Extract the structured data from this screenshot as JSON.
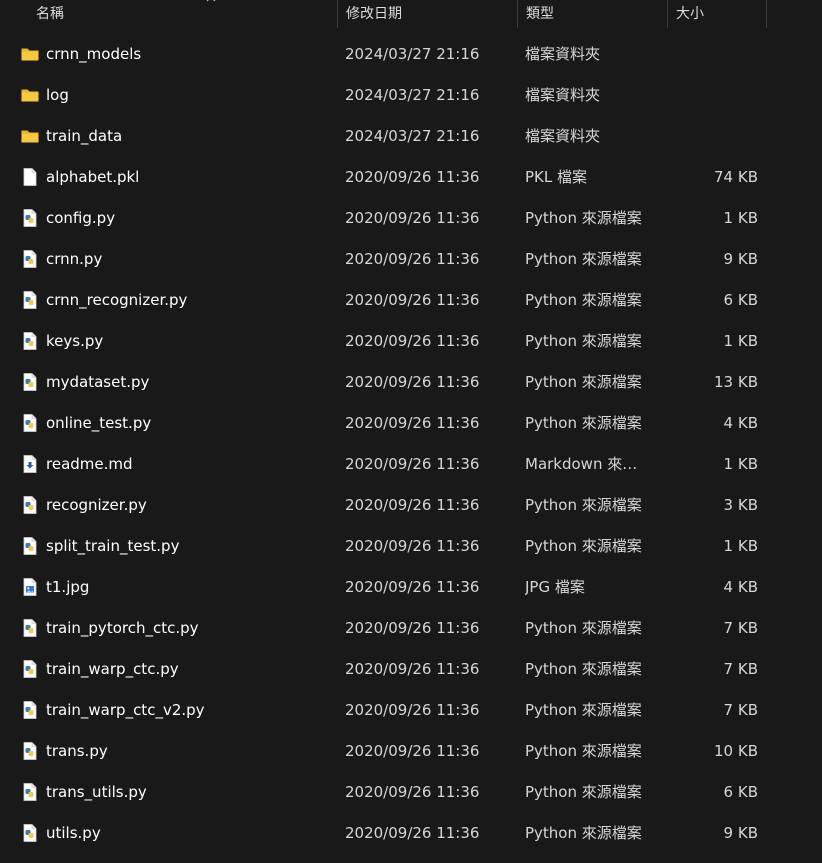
{
  "columns": {
    "name": "名稱",
    "modified": "修改日期",
    "type": "類型",
    "size": "大小"
  },
  "files": [
    {
      "name": "crnn_models",
      "modified": "2024/03/27 21:16",
      "type": "檔案資料夾",
      "size": "",
      "icon": "folder-icon"
    },
    {
      "name": "log",
      "modified": "2024/03/27 21:16",
      "type": "檔案資料夾",
      "size": "",
      "icon": "folder-icon"
    },
    {
      "name": "train_data",
      "modified": "2024/03/27 21:16",
      "type": "檔案資料夾",
      "size": "",
      "icon": "folder-icon"
    },
    {
      "name": "alphabet.pkl",
      "modified": "2020/09/26 11:36",
      "type": "PKL 檔案",
      "size": "74 KB",
      "icon": "blank-file-icon"
    },
    {
      "name": "config.py",
      "modified": "2020/09/26 11:36",
      "type": "Python 來源檔案",
      "size": "1 KB",
      "icon": "python-file-icon"
    },
    {
      "name": "crnn.py",
      "modified": "2020/09/26 11:36",
      "type": "Python 來源檔案",
      "size": "9 KB",
      "icon": "python-file-icon"
    },
    {
      "name": "crnn_recognizer.py",
      "modified": "2020/09/26 11:36",
      "type": "Python 來源檔案",
      "size": "6 KB",
      "icon": "python-file-icon"
    },
    {
      "name": "keys.py",
      "modified": "2020/09/26 11:36",
      "type": "Python 來源檔案",
      "size": "1 KB",
      "icon": "python-file-icon"
    },
    {
      "name": "mydataset.py",
      "modified": "2020/09/26 11:36",
      "type": "Python 來源檔案",
      "size": "13 KB",
      "icon": "python-file-icon"
    },
    {
      "name": "online_test.py",
      "modified": "2020/09/26 11:36",
      "type": "Python 來源檔案",
      "size": "4 KB",
      "icon": "python-file-icon"
    },
    {
      "name": "readme.md",
      "modified": "2020/09/26 11:36",
      "type": "Markdown 來源檔案",
      "size": "1 KB",
      "icon": "markdown-file-icon"
    },
    {
      "name": "recognizer.py",
      "modified": "2020/09/26 11:36",
      "type": "Python 來源檔案",
      "size": "3 KB",
      "icon": "python-file-icon"
    },
    {
      "name": "split_train_test.py",
      "modified": "2020/09/26 11:36",
      "type": "Python 來源檔案",
      "size": "1 KB",
      "icon": "python-file-icon"
    },
    {
      "name": "t1.jpg",
      "modified": "2020/09/26 11:36",
      "type": "JPG 檔案",
      "size": "4 KB",
      "icon": "image-file-icon"
    },
    {
      "name": "train_pytorch_ctc.py",
      "modified": "2020/09/26 11:36",
      "type": "Python 來源檔案",
      "size": "7 KB",
      "icon": "python-file-icon"
    },
    {
      "name": "train_warp_ctc.py",
      "modified": "2020/09/26 11:36",
      "type": "Python 來源檔案",
      "size": "7 KB",
      "icon": "python-file-icon"
    },
    {
      "name": "train_warp_ctc_v2.py",
      "modified": "2020/09/26 11:36",
      "type": "Python 來源檔案",
      "size": "7 KB",
      "icon": "python-file-icon"
    },
    {
      "name": "trans.py",
      "modified": "2020/09/26 11:36",
      "type": "Python 來源檔案",
      "size": "10 KB",
      "icon": "python-file-icon"
    },
    {
      "name": "trans_utils.py",
      "modified": "2020/09/26 11:36",
      "type": "Python 來源檔案",
      "size": "6 KB",
      "icon": "python-file-icon"
    },
    {
      "name": "utils.py",
      "modified": "2020/09/26 11:36",
      "type": "Python 來源檔案",
      "size": "9 KB",
      "icon": "python-file-icon"
    }
  ],
  "colors": {
    "background": "#191919",
    "folder": "#f8c93b",
    "python_blue": "#3a78b8",
    "python_yellow": "#f2c94c"
  }
}
